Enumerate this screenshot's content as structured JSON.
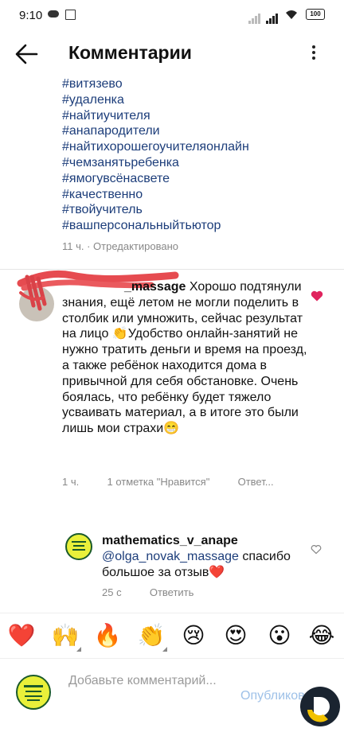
{
  "status_bar": {
    "time": "9:10",
    "battery": "100"
  },
  "header": {
    "title": "Комментарии"
  },
  "caption": {
    "hashtags": [
      "#витязево",
      "#удаленка",
      "#найтиучителя",
      "#анапародители",
      "#найтихорошегоучителяонлайн",
      "#чемзанятьребенка",
      "#ямогувсёнасвете",
      "#качественно",
      "#твойучитель",
      "#вашперсональныйтьютор"
    ],
    "meta": "11 ч. · Отредактировано"
  },
  "comment": {
    "username": "_massage",
    "text": " Хорошо подтянули знания, ещё летом не могли поделить в столбик или умножить, сейчас результат на лицо 👏Удобство онлайн-занятий не нужно тратить деньги и время на проезд, а также ребёнок находится дома в привычной для себя обстановке. Очень боялась, что ребёнку будет тяжело усваивать материал, а в итоге это были лишь мои страхи😁",
    "time": "1 ч.",
    "likes": "1 отметка \"Нравится\"",
    "reply_label": "Ответ..."
  },
  "reply": {
    "username": "mathematics_v_anape",
    "mention": "@olga_novak_massage",
    "text": " спасибо большое за отзыв❤️",
    "time": "25 с",
    "reply_label": "Ответить"
  },
  "emoji_bar": [
    "❤️",
    "🙌",
    "🔥",
    "👏",
    "😢",
    "😍",
    "😮",
    "😂"
  ],
  "composer": {
    "placeholder": "Добавьте комментарий...",
    "publish_label": "Опубликовать"
  },
  "colors": {
    "link": "#1c3d7a",
    "like_red": "#e0245e",
    "publish": "#9ec1e8"
  }
}
